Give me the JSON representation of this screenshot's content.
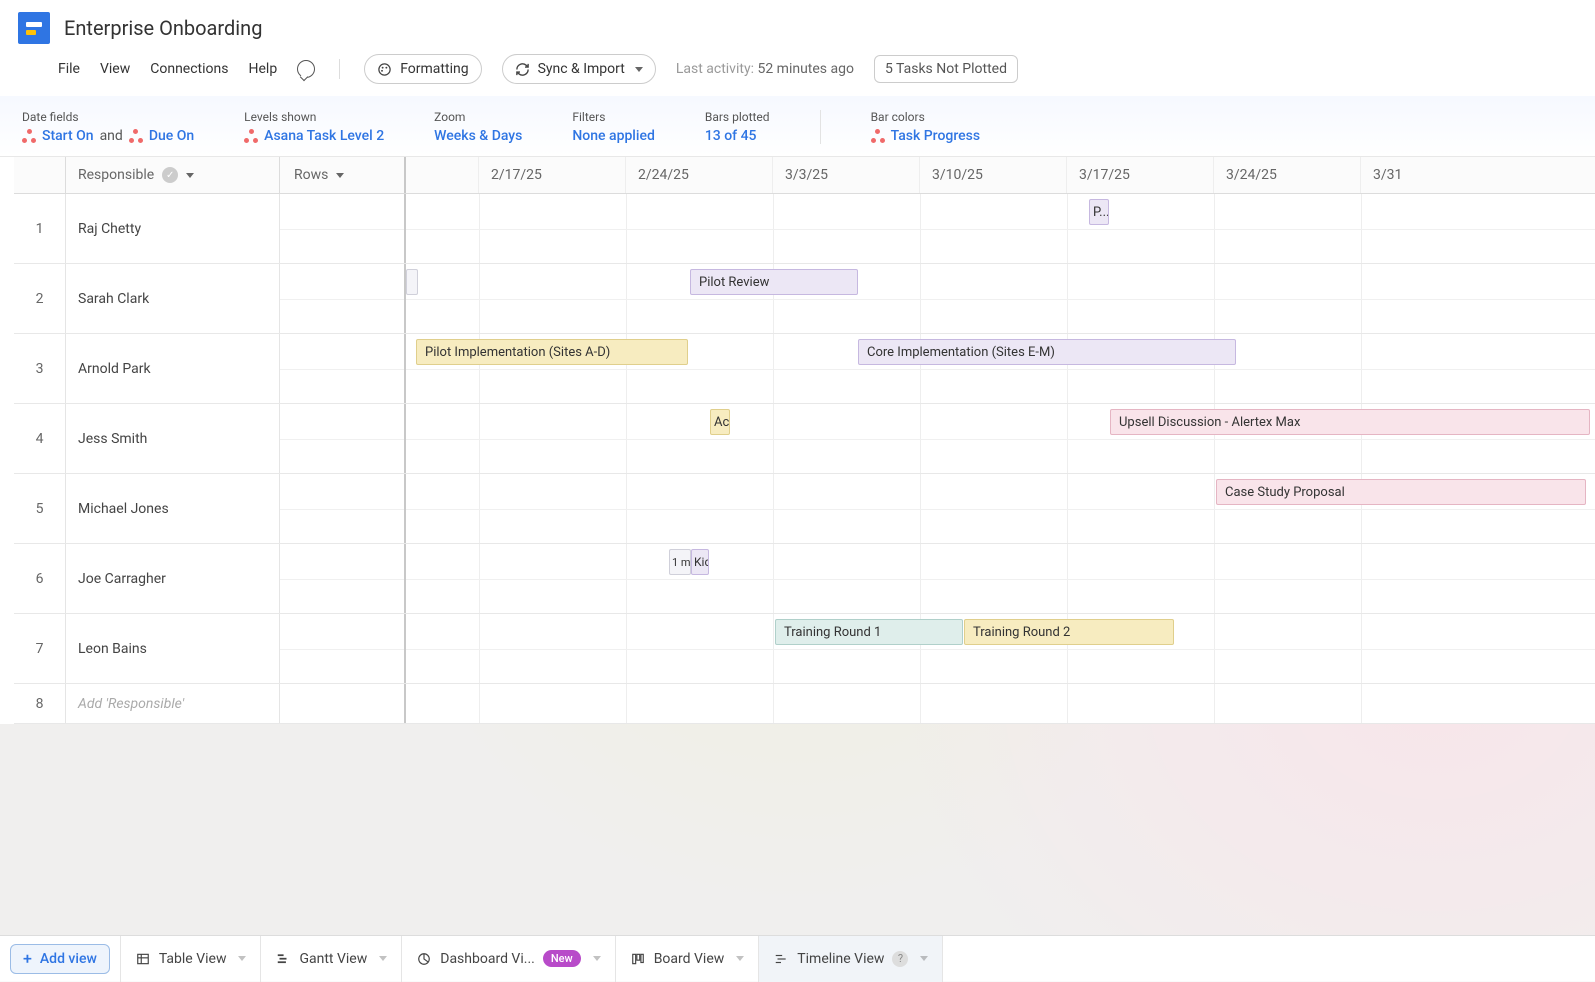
{
  "header": {
    "title": "Enterprise Onboarding"
  },
  "menu": {
    "file": "File",
    "view": "View",
    "connections": "Connections",
    "help": "Help",
    "formatting": "Formatting",
    "sync_import": "Sync & Import",
    "last_activity_label": "Last activity:",
    "last_activity_value": "52 minutes ago",
    "not_plotted": "5 Tasks Not Plotted"
  },
  "toolbar": {
    "date_fields_label": "Date fields",
    "date_field_start": "Start On",
    "date_field_and": "and",
    "date_field_due": "Due On",
    "levels_label": "Levels shown",
    "levels_value": "Asana Task Level 2",
    "zoom_label": "Zoom",
    "zoom_value": "Weeks & Days",
    "filters_label": "Filters",
    "filters_value": "None applied",
    "bars_label": "Bars plotted",
    "bars_value": "13 of 45",
    "colors_label": "Bar colors",
    "colors_value": "Task Progress"
  },
  "columns": {
    "responsible": "Responsible",
    "rows": "Rows",
    "dates": [
      "2/17/25",
      "2/24/25",
      "3/3/25",
      "3/10/25",
      "3/17/25",
      "3/24/25",
      "3/31"
    ]
  },
  "rows": [
    {
      "num": "1",
      "name": "Raj Chetty"
    },
    {
      "num": "2",
      "name": "Sarah Clark"
    },
    {
      "num": "3",
      "name": "Arnold Park"
    },
    {
      "num": "4",
      "name": "Jess Smith"
    },
    {
      "num": "5",
      "name": "Michael Jones"
    },
    {
      "num": "6",
      "name": "Joe Carragher"
    },
    {
      "num": "7",
      "name": "Leon Bains"
    }
  ],
  "add_row_placeholder": "Add 'Responsible'",
  "add_row_num": "8",
  "bars": {
    "p_trunc": "P...",
    "pilot_review": "Pilot Review",
    "pilot_impl": "Pilot Implementation (Sites A-D)",
    "core_impl": "Core Implementation (Sites E-M)",
    "ac_trunc": "Ac",
    "upsell": "Upsell Discussion - Alertex Max",
    "case_study": "Case Study Proposal",
    "one_m": "1 m",
    "kic": "Kic",
    "training1": "Training Round 1",
    "training2": "Training Round 2"
  },
  "footer": {
    "add_view": "Add view",
    "table": "Table View",
    "gantt": "Gantt View",
    "dashboard": "Dashboard Vi...",
    "new_badge": "New",
    "board": "Board View",
    "timeline": "Timeline View"
  }
}
